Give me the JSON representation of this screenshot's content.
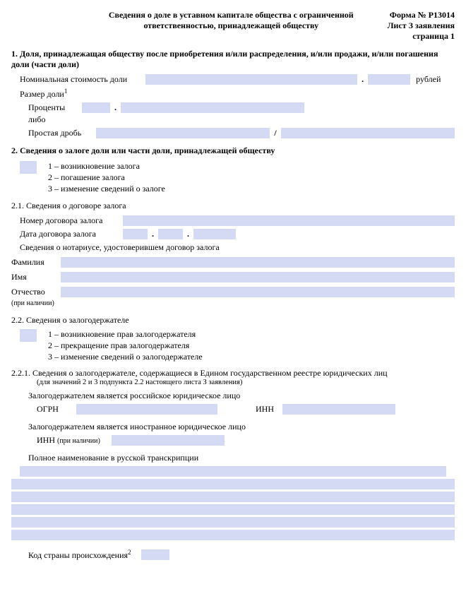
{
  "header": {
    "title_l1": "Сведения о доле в уставном капитале общества с ограниченной",
    "title_l2": "ответственностью, принадлежащей обществу",
    "form_no": "Форма № Р13014",
    "sheet": "Лист З заявления",
    "page": "страница 1"
  },
  "s1": {
    "heading": "1. Доля, принадлежащая обществу после приобретения и/или распределения, и/или продажи, и/или погашения доли (части доли)",
    "nominal_label": "Номинальная стоимость доли",
    "rub": "рублей",
    "size_label": "Размер доли",
    "size_sup": "1",
    "percent_label": "Проценты",
    "or_label": "либо",
    "fraction_label": "Простая дробь"
  },
  "s2": {
    "heading": "2. Сведения о залоге доли или части доли, принадлежащей обществу",
    "opts": {
      "o1": "1 – возникновение залога",
      "o2": "2 – погашение залога",
      "o3": "3 – изменение сведений о залоге"
    }
  },
  "s21": {
    "heading": "2.1. Сведения о договоре залога",
    "num_label": "Номер договора залога",
    "date_label": "Дата договора залога",
    "notary_label": "Сведения о нотариусе, удостоверившем договор залога",
    "fam": "Фамилия",
    "name": "Имя",
    "patr": "Отчество",
    "patr_note": "(при наличии)"
  },
  "s22": {
    "heading": "2.2. Сведения о залогодержателе",
    "opts": {
      "o1": "1 – возникновение прав залогодержателя",
      "o2": "2 – прекращение прав залогодержателя",
      "o3": "3 – изменение сведений о залогодержателе"
    }
  },
  "s221": {
    "heading": "2.2.1. Сведения о залогодержателе, содержащиеся в Едином государственном реестре юридических лиц",
    "note": "(для значений 2 и 3 подпункта 2.2 настоящего листа З заявления)",
    "rus_label": "Залогодержателем является российское юридическое лицо",
    "ogrn": "ОГРН",
    "inn": "ИНН",
    "foreign_label": "Залогодержателем является иностранное юридическое лицо",
    "inn2": "ИНН",
    "inn2_note": "(при наличии)",
    "fullname_label": "Полное наименование в русской транскрипции",
    "country_label": "Код страны происхождения",
    "country_sup": "2"
  }
}
